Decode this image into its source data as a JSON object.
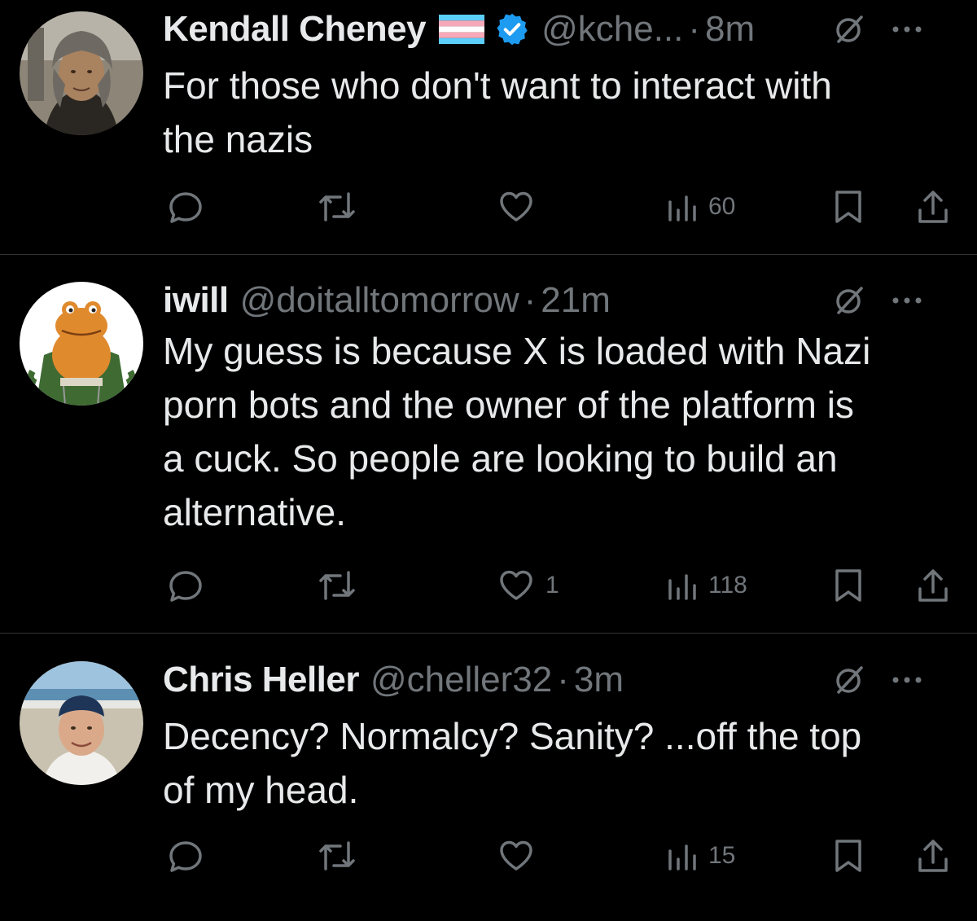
{
  "colors": {
    "background": "#000000",
    "text_primary": "#e7e9ea",
    "text_secondary": "#71767b",
    "divider": "#2f3336",
    "verified_badge": "#1d9bf0",
    "flag_blue": "#5bcefa",
    "flag_pink": "#f5a9b8"
  },
  "tweets": [
    {
      "display_name": "Kendall Cheney",
      "flag": "transgender-flag-icon",
      "verified": true,
      "handle": "@kche...",
      "sep": "·",
      "time": "8m",
      "body_lines": [
        "For those who don't want to interact with",
        "the nazis"
      ],
      "actions": {
        "reply": "",
        "retweet": "",
        "like": "",
        "views": "60"
      }
    },
    {
      "display_name": "iwill",
      "handle": "@doitalltomorrow",
      "sep": "·",
      "time": "21m",
      "body_lines": [
        "My guess is because X is loaded with Nazi",
        "porn bots and the owner of the platform is",
        "a cuck. So people are looking to build an",
        "alternative."
      ],
      "actions": {
        "reply": "",
        "retweet": "",
        "like": "1",
        "views": "118"
      }
    },
    {
      "display_name": "Chris Heller",
      "handle": "@cheller32",
      "sep": "·",
      "time": "3m",
      "body_lines": [
        "Decency? Normalcy? Sanity? ...off the top",
        "of my head."
      ],
      "actions": {
        "reply": "",
        "retweet": "",
        "like": "",
        "views": "15"
      }
    }
  ],
  "icons": {
    "avatar": "avatar",
    "grok": "grok-icon",
    "more": "more-icon",
    "reply": "reply-icon",
    "retweet": "retweet-icon",
    "like": "heart-icon",
    "views": "views-icon",
    "bookmark": "bookmark-icon",
    "share": "share-icon"
  }
}
